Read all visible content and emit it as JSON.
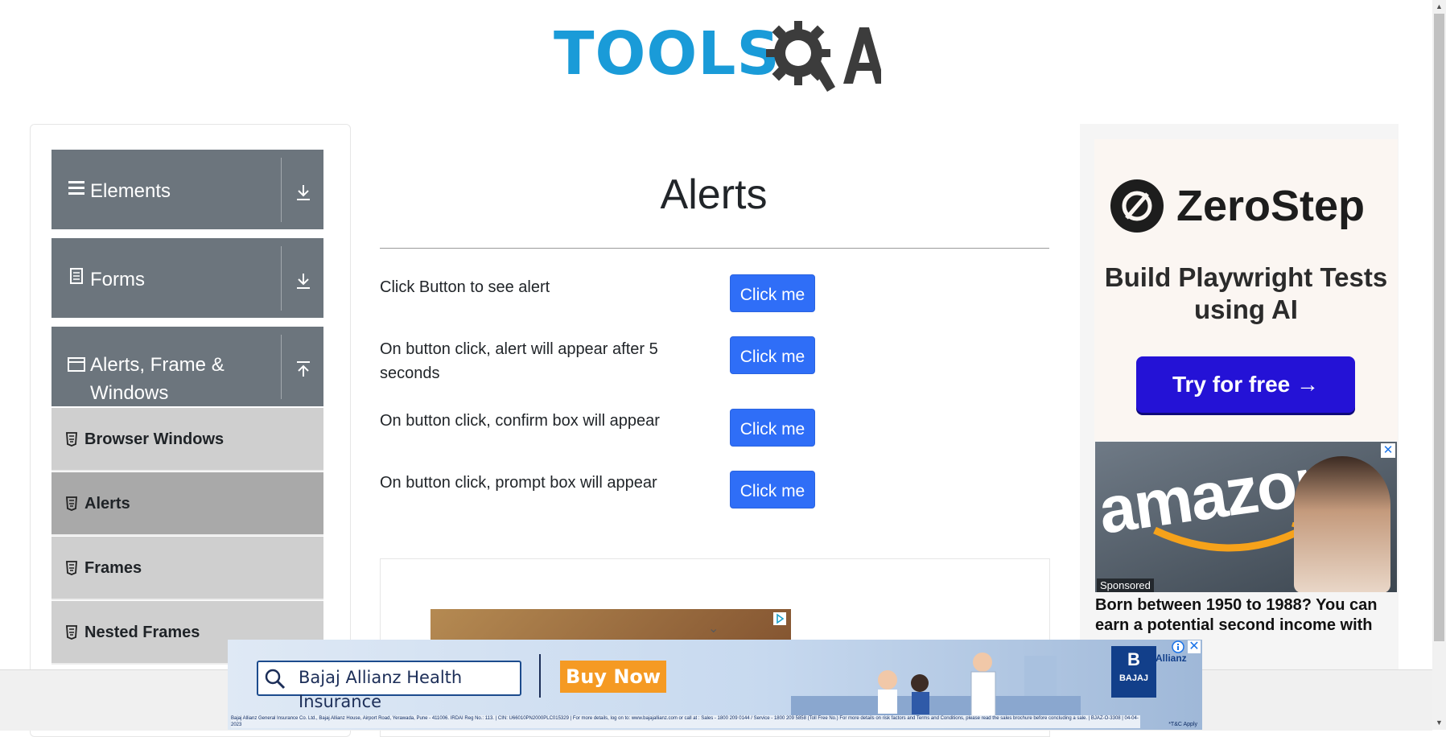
{
  "header": {
    "logo_text_tools": "TOOLS",
    "logo_text_qa": "QA"
  },
  "sidebar": {
    "groups": [
      {
        "label": "Elements",
        "icon": "hamburger-icon",
        "arrow": "download-icon"
      },
      {
        "label": "Forms",
        "icon": "document-icon",
        "arrow": "download-icon"
      },
      {
        "label": "Alerts, Frame & Windows",
        "label_line1": "Alerts, Frame &",
        "label_line2": "Windows",
        "icon": "window-icon",
        "arrow": "upload-icon"
      }
    ],
    "items": [
      {
        "label": "Browser Windows",
        "active": false
      },
      {
        "label": "Alerts",
        "active": true
      },
      {
        "label": "Frames",
        "active": false
      },
      {
        "label": "Nested Frames",
        "active": false
      }
    ]
  },
  "main": {
    "title": "Alerts",
    "rows": [
      {
        "label": "Click Button to see alert",
        "button": "Click me"
      },
      {
        "label": "On button click, alert will appear after 5 seconds",
        "button": "Click me"
      },
      {
        "label": "On button click, confirm box will appear",
        "button": "Click me"
      },
      {
        "label": "On button click, prompt box will appear",
        "button": "Click me"
      }
    ]
  },
  "right_ad": {
    "brand": "ZeroStep",
    "tagline": "Build Playwright Tests using AI",
    "cta": "Try for free →",
    "amazon_word": "amazon",
    "sponsored": "Sponsored",
    "amazon_text": "Born between 1950 to 1988? You can earn a potential second income with"
  },
  "bottom_banner": {
    "search_text": "Bajaj Allianz Health Insurance",
    "buy_now": "Buy Now",
    "bajaj_label": "BAJAJ",
    "allianz_label": "Allianz",
    "fine_print": "Bajaj Allianz General Insurance Co. Ltd., Bajaj Allianz House, Airport Road, Yerawada, Pune - 411006. IRDAI Reg No.: 113. | CIN: U66010PN2000PLC015329 | For more details, log on to: www.bajajallianz.com or call at : Sales - 1800 209 0144 / Service - 1800 209 5858 (Toll Free No.) For more details on risk factors and Terms and Conditions, please read the sales brochure before concluding a sale. | BJAZ-O-3308 | 04-04-2023",
    "tc": "*T&C Apply"
  },
  "colors": {
    "logo_blue": "#1a9bd8",
    "logo_dark": "#3c3c3c",
    "sidebar_group_bg": "#6c757d",
    "menu_item_bg": "#cfcfcf",
    "menu_item_active_bg": "#a9a9a9",
    "primary_button": "#2f6ef7",
    "zerostep_button": "#2412d6",
    "buy_now": "#f59a23"
  }
}
